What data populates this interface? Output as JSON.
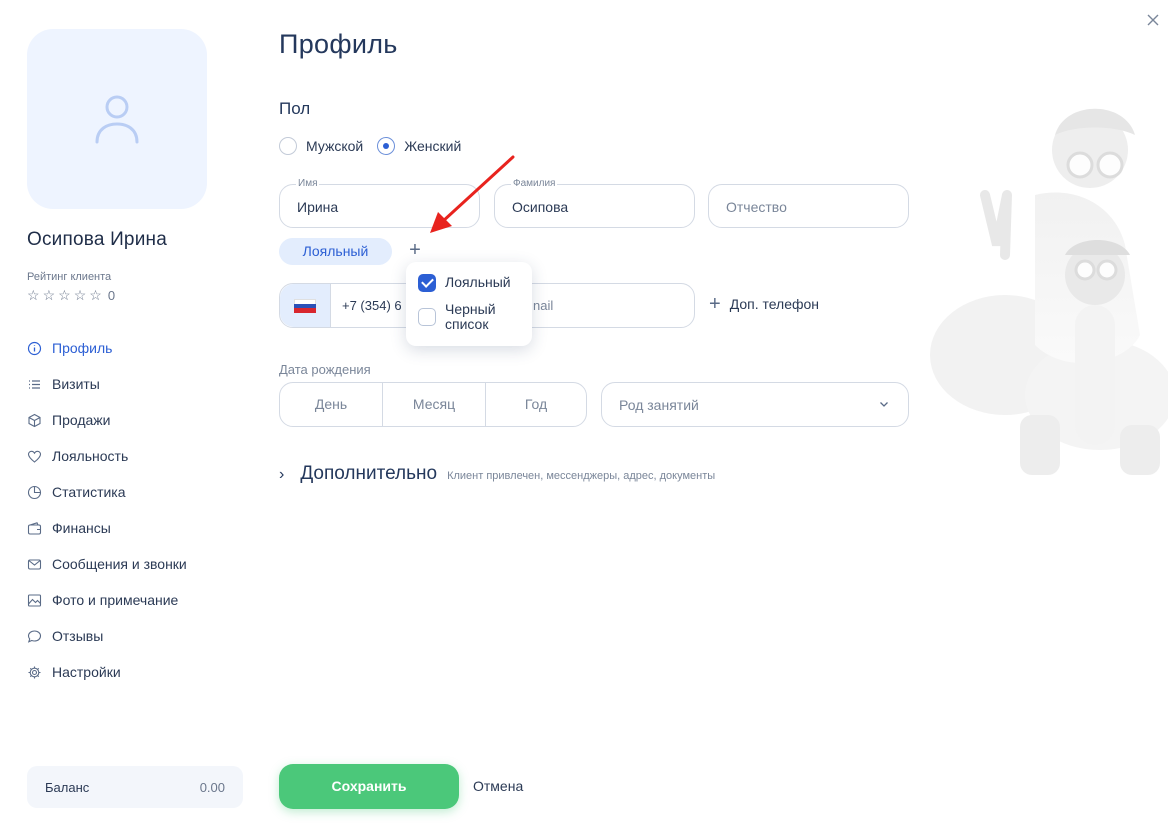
{
  "sidebar": {
    "client_name": "Осипова Ирина",
    "rating_label": "Рейтинг клиента",
    "rating_value": "0",
    "rating_stars": 0,
    "nav": [
      {
        "label": "Профиль",
        "icon": "info-circle-icon",
        "active": true
      },
      {
        "label": "Визиты",
        "icon": "list-icon",
        "active": false
      },
      {
        "label": "Продажи",
        "icon": "box-icon",
        "active": false
      },
      {
        "label": "Лояльность",
        "icon": "heart-icon",
        "active": false
      },
      {
        "label": "Статистика",
        "icon": "pie-chart-icon",
        "active": false
      },
      {
        "label": "Финансы",
        "icon": "wallet-icon",
        "active": false
      },
      {
        "label": "Сообщения и звонки",
        "icon": "mail-icon",
        "active": false
      },
      {
        "label": "Фото и примечание",
        "icon": "image-icon",
        "active": false
      },
      {
        "label": "Отзывы",
        "icon": "chat-bubble-icon",
        "active": false
      },
      {
        "label": "Настройки",
        "icon": "gear-icon",
        "active": false
      }
    ],
    "balance": {
      "label": "Баланс",
      "value": "0.00"
    }
  },
  "main": {
    "title": "Профиль",
    "gender": {
      "heading": "Пол",
      "options": [
        {
          "label": "Мужской",
          "checked": false
        },
        {
          "label": "Женский",
          "checked": true
        }
      ]
    },
    "first_name": {
      "label": "Имя",
      "value": "Ирина"
    },
    "last_name": {
      "label": "Фамилия",
      "value": "Осипова"
    },
    "middle_name": {
      "placeholder": "Отчество"
    },
    "tag": "Лояльный",
    "phone": {
      "value": "+7 (354) 6",
      "email_placeholder": "nail",
      "add_phone_label": "Доп. телефон"
    },
    "tag_dropdown": [
      {
        "label": "Лояльный",
        "checked": true
      },
      {
        "label": "Черный список",
        "checked": false
      }
    ],
    "birthdate": {
      "label": "Дата рождения",
      "day": "День",
      "month": "Месяц",
      "year": "Год"
    },
    "occupation_placeholder": "Род занятий",
    "more": {
      "title": "Дополнительно",
      "subtitle": "Клиент привлечен, мессенджеры, адрес, документы"
    },
    "save_label": "Сохранить",
    "cancel_label": "Отмена"
  },
  "colors": {
    "accent": "#2c5fd4",
    "save": "#4bc87a",
    "tag_bg": "#e3edfd",
    "arrow": "#e8231e"
  }
}
